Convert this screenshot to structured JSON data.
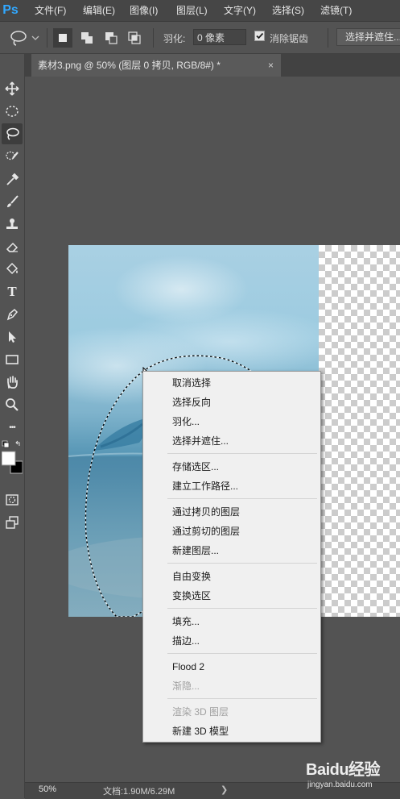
{
  "app": {
    "logo": "Ps"
  },
  "menubar": {
    "items": [
      "文件(F)",
      "编辑(E)",
      "图像(I)",
      "图层(L)",
      "文字(Y)",
      "选择(S)",
      "滤镜(T)"
    ]
  },
  "options": {
    "feather_label": "羽化:",
    "feather_value": "0 像素",
    "antialias_checked": true,
    "antialias_label": "消除锯齿",
    "select_mask_label": "选择并遮住..."
  },
  "tabs": {
    "document_title": "素材3.png @ 50% (图层 0 拷贝, RGB/8#) *",
    "close_glyph": "×"
  },
  "tools": [
    "move-icon",
    "marquee-icon",
    "lasso-icon",
    "quick-select-icon",
    "eyedropper-icon",
    "brush-icon",
    "stamp-icon",
    "eraser-icon",
    "paint-bucket-icon",
    "type-icon",
    "pen-icon",
    "path-select-icon",
    "rectangle-icon",
    "hand-icon",
    "zoom-icon",
    "more-icon"
  ],
  "tool_glyphs": {
    "type": "T",
    "more": "•••"
  },
  "context_menu": {
    "groups": [
      [
        "取消选择",
        "选择反向",
        "羽化...",
        "选择并遮住..."
      ],
      [
        "存储选区...",
        "建立工作路径..."
      ],
      [
        "通过拷贝的图层",
        "通过剪切的图层",
        "新建图层..."
      ],
      [
        "自由变换",
        "变换选区"
      ],
      [
        "填充...",
        "描边..."
      ],
      [
        "Flood 2",
        "渐隐..."
      ],
      [
        "渲染 3D 图层",
        "新建 3D 模型"
      ]
    ],
    "disabled": [
      "渐隐...",
      "渲染 3D 图层"
    ]
  },
  "status": {
    "zoom": "50%",
    "doc_size": "文档:1.90M/6.29M",
    "arrow": "❯"
  },
  "watermark": {
    "brand": "Baidu经验",
    "url": "jingyan.baidu.com"
  },
  "colors": {
    "ps_blue": "#31a8ff",
    "menu_bg": "#f0f0f0",
    "chrome_bg": "#535353"
  }
}
